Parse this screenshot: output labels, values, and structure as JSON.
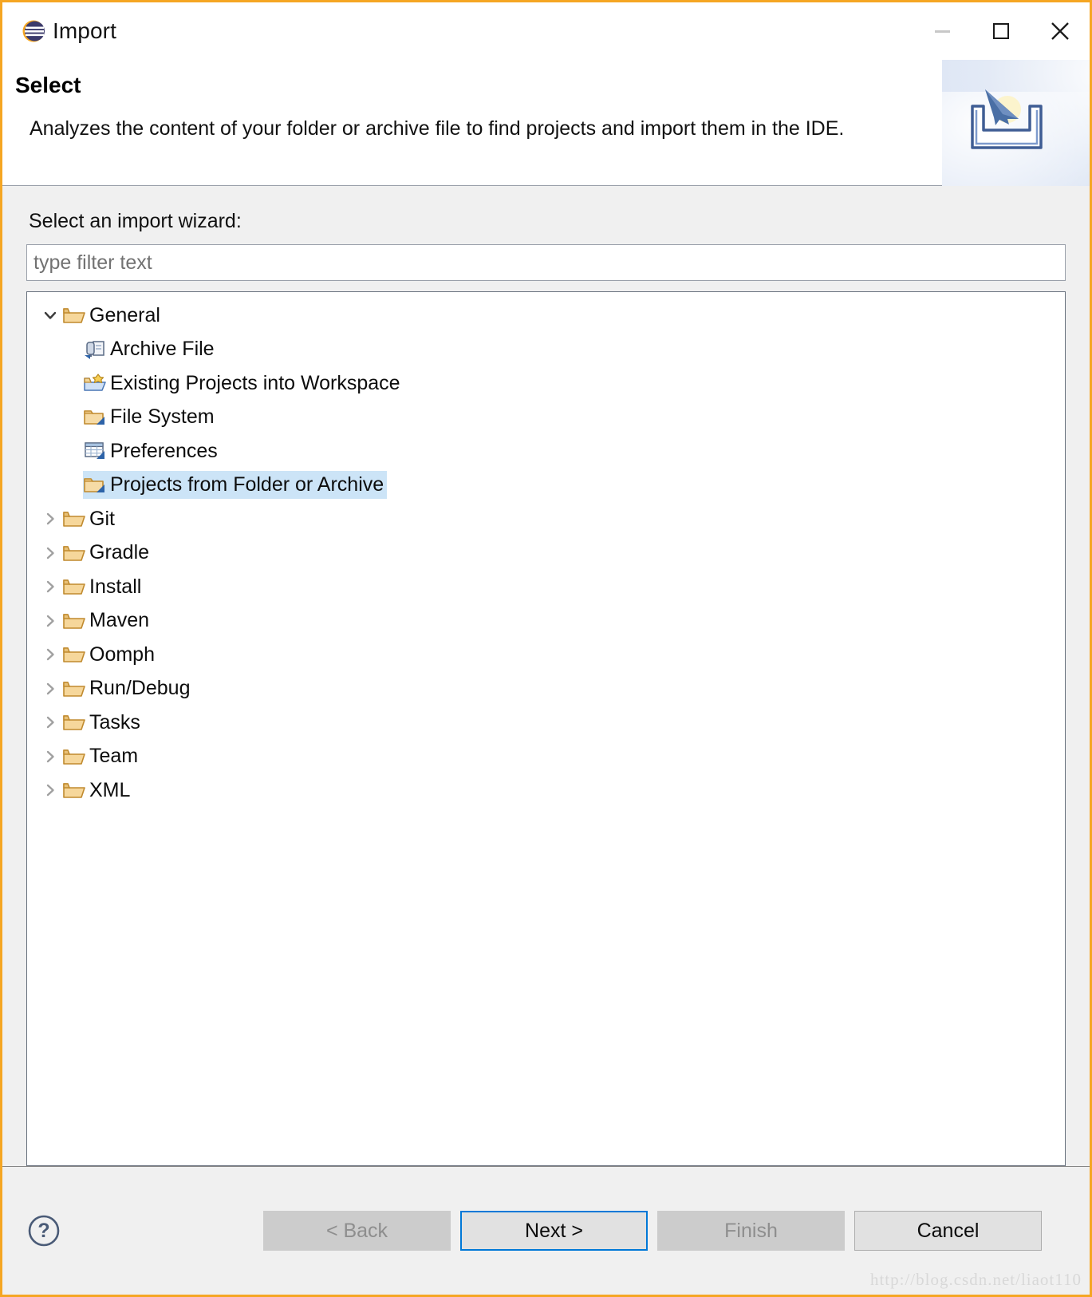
{
  "window": {
    "title": "Import",
    "icon": "eclipse-logo-icon",
    "border_color": "#f5a623",
    "controls": {
      "minimize": "minimize-icon",
      "maximize": "maximize-icon",
      "close": "close-icon"
    }
  },
  "header": {
    "title": "Select",
    "description": "Analyzes the content of your folder or archive file to find projects and import them in the IDE.",
    "banner_icon": "import-arrow-into-tray-icon"
  },
  "main": {
    "field_label": "Select an import wizard:",
    "filter": {
      "value": "",
      "placeholder": "type filter text"
    },
    "tree": {
      "selected_color": "#cce4f7",
      "nodes": [
        {
          "label": "General",
          "icon": "open-folder-icon",
          "twisty": "chevron-down-icon",
          "expanded": true,
          "selected": false,
          "children": [
            {
              "label": "Archive File",
              "icon": "archive-file-icon",
              "selected": false
            },
            {
              "label": "Existing Projects into Workspace",
              "icon": "existing-projects-folder-icon",
              "selected": false
            },
            {
              "label": "File System",
              "icon": "file-system-folder-icon",
              "selected": false
            },
            {
              "label": "Preferences",
              "icon": "preferences-table-icon",
              "selected": false
            },
            {
              "label": "Projects from Folder or Archive",
              "icon": "projects-folder-icon",
              "selected": true
            }
          ]
        },
        {
          "label": "Git",
          "icon": "open-folder-icon",
          "twisty": "chevron-right-icon",
          "expanded": false,
          "selected": false,
          "children": []
        },
        {
          "label": "Gradle",
          "icon": "open-folder-icon",
          "twisty": "chevron-right-icon",
          "expanded": false,
          "selected": false,
          "children": []
        },
        {
          "label": "Install",
          "icon": "open-folder-icon",
          "twisty": "chevron-right-icon",
          "expanded": false,
          "selected": false,
          "children": []
        },
        {
          "label": "Maven",
          "icon": "open-folder-icon",
          "twisty": "chevron-right-icon",
          "expanded": false,
          "selected": false,
          "children": []
        },
        {
          "label": "Oomph",
          "icon": "open-folder-icon",
          "twisty": "chevron-right-icon",
          "expanded": false,
          "selected": false,
          "children": []
        },
        {
          "label": "Run/Debug",
          "icon": "open-folder-icon",
          "twisty": "chevron-right-icon",
          "expanded": false,
          "selected": false,
          "children": []
        },
        {
          "label": "Tasks",
          "icon": "open-folder-icon",
          "twisty": "chevron-right-icon",
          "expanded": false,
          "selected": false,
          "children": []
        },
        {
          "label": "Team",
          "icon": "open-folder-icon",
          "twisty": "chevron-right-icon",
          "expanded": false,
          "selected": false,
          "children": []
        },
        {
          "label": "XML",
          "icon": "open-folder-icon",
          "twisty": "chevron-right-icon",
          "expanded": false,
          "selected": false,
          "children": []
        }
      ]
    }
  },
  "footer": {
    "help_icon": "help-question-icon",
    "buttons": [
      {
        "label": "< Back",
        "state": "disabled",
        "name": "back-button"
      },
      {
        "label": "Next >",
        "state": "default",
        "name": "next-button"
      },
      {
        "label": "Finish",
        "state": "disabled",
        "name": "finish-button"
      },
      {
        "label": "Cancel",
        "state": "normal",
        "name": "cancel-button"
      }
    ],
    "watermark": "http://blog.csdn.net/liaot110"
  }
}
